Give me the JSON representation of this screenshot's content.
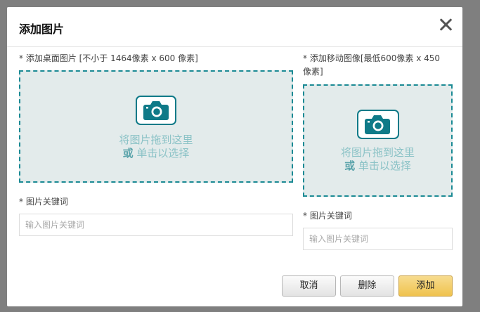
{
  "dialog": {
    "title": "添加图片"
  },
  "desktop": {
    "label": "* 添加桌面图片 [不小于 1464像素 x 600 像素]",
    "drop_line1": "将图片拖到这里",
    "drop_or": "或",
    "drop_line2": " 单击以选择",
    "keyword_label": "* 图片关键词",
    "keyword_placeholder": "输入图片关键词"
  },
  "mobile": {
    "label_line1": "* 添加移动图像[最低600像素 x 450",
    "label_line2": "像素]",
    "drop_line1": "将图片拖到这里",
    "drop_or": "或",
    "drop_line2": " 单击以选择",
    "keyword_label": "* 图片关键词",
    "keyword_placeholder": "输入图片关键词"
  },
  "buttons": {
    "cancel": "取消",
    "delete": "删除",
    "add": "添加"
  },
  "colors": {
    "accent": "#1b8a94",
    "primary_button": "#efc24d"
  }
}
